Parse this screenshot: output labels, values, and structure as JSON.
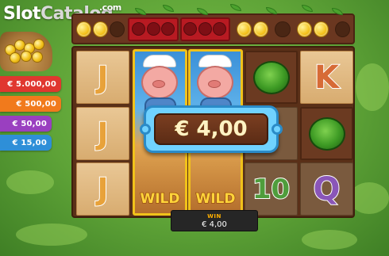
{
  "watermark": {
    "part1": "Slot",
    "part2": "Catalog",
    "suffix": ".com"
  },
  "jackpots": [
    {
      "amount": "€ 5.000,00",
      "color": "#e0372f"
    },
    {
      "amount": "€ 500,00",
      "color": "#f17a1c"
    },
    {
      "amount": "€ 50,00",
      "color": "#9a3fc0"
    },
    {
      "amount": "€ 15,00",
      "color": "#2e8fd8"
    }
  ],
  "top_row": {
    "collect_icon": "gold-coin-icon",
    "locked_icon": "red-crate-icon"
  },
  "reels": {
    "symbols": {
      "j": "J",
      "k": "K",
      "ten": "10",
      "q": "Q",
      "wild": "WILD"
    },
    "veg_icon": "cabbage-icon",
    "wild_character": "pig-farmer"
  },
  "win_popup": {
    "amount": "€ 4,00"
  },
  "win_bar": {
    "label": "WIN",
    "value": "€ 4,00"
  },
  "colors": {
    "grass": "#5ea337",
    "board": "#5a3018",
    "plaque_frame": "#70d2ff",
    "wild_border": "#f1c21a"
  }
}
